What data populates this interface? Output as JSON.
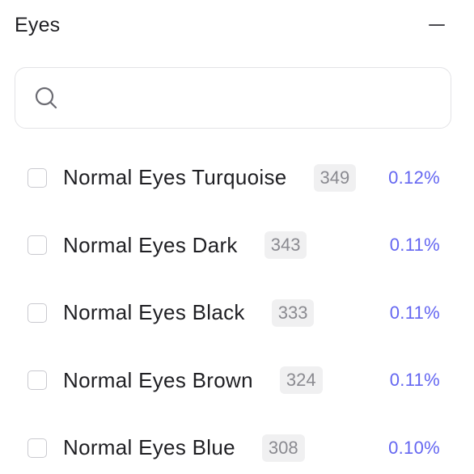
{
  "header": {
    "title": "Eyes",
    "collapse_icon": "minus-icon"
  },
  "search": {
    "value": "",
    "placeholder": "",
    "icon": "search-icon"
  },
  "colors": {
    "accent": "#6466f1",
    "count_bg": "#f0f0f1",
    "border": "#e3e3e6"
  },
  "items": [
    {
      "label": "Normal Eyes Turquoise",
      "count": "349",
      "percent": "0.12%",
      "checked": false
    },
    {
      "label": "Normal Eyes Dark",
      "count": "343",
      "percent": "0.11%",
      "checked": false
    },
    {
      "label": "Normal Eyes Black",
      "count": "333",
      "percent": "0.11%",
      "checked": false
    },
    {
      "label": "Normal Eyes Brown",
      "count": "324",
      "percent": "0.11%",
      "checked": false
    },
    {
      "label": "Normal Eyes Blue",
      "count": "308",
      "percent": "0.10%",
      "checked": false
    }
  ]
}
